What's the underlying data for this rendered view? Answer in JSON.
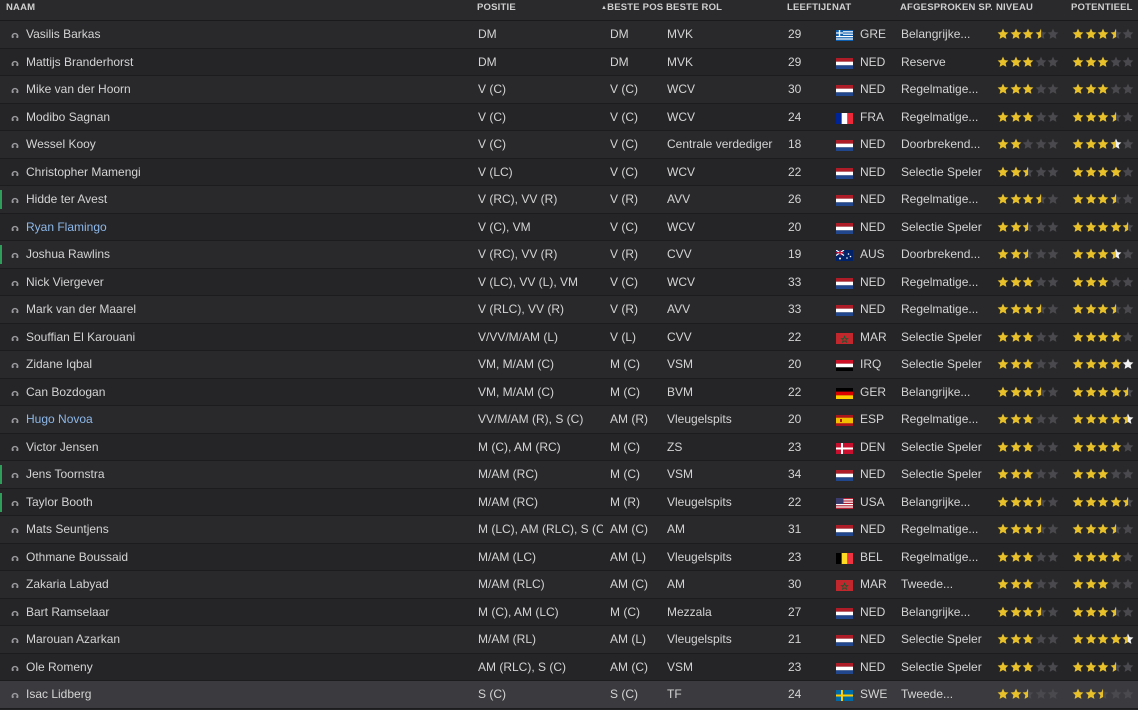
{
  "columns": [
    {
      "key": "naam",
      "label": "NAAM"
    },
    {
      "key": "positie",
      "label": "POSITIE"
    },
    {
      "key": "beste_pos",
      "label": "BESTE POS"
    },
    {
      "key": "beste_rol",
      "label": "BESTE ROL"
    },
    {
      "key": "leeftijd",
      "label": "LEEFTIJD"
    },
    {
      "key": "nat",
      "label": "NAT"
    },
    {
      "key": "afgesproken",
      "label": "AFGESPROKEN SP..."
    },
    {
      "key": "niveau",
      "label": "NIVEAU"
    },
    {
      "key": "potentieel",
      "label": "POTENTIEEL"
    }
  ],
  "sort": {
    "column": "beste_pos",
    "indicator": "▲"
  },
  "colors": {
    "star_filled": "#e8c12a",
    "star_empty": "#4a4a4e",
    "star_white": "#f2f2f2",
    "link": "#8db8e8",
    "accent": "#2e9e5a"
  },
  "rows": [
    {
      "name": "Vasilis Barkas",
      "positie": "DM",
      "beste_pos": "DM",
      "beste_rol": "MVK",
      "leeftijd": "29",
      "nat": "GRE",
      "flag": "gre",
      "afgesproken": "Belangrijke...",
      "niveau": 3.5,
      "potentieel": 3.5
    },
    {
      "name": "Mattijs Branderhorst",
      "positie": "DM",
      "beste_pos": "DM",
      "beste_rol": "MVK",
      "leeftijd": "29",
      "nat": "NED",
      "flag": "ned",
      "afgesproken": "Reserve",
      "niveau": 3,
      "potentieel": 3
    },
    {
      "name": "Mike van der Hoorn",
      "positie": "V (C)",
      "beste_pos": "V (C)",
      "beste_rol": "WCV",
      "leeftijd": "30",
      "nat": "NED",
      "flag": "ned",
      "afgesproken": "Regelmatige...",
      "niveau": 3,
      "potentieel": 3
    },
    {
      "name": "Modibo Sagnan",
      "positie": "V (C)",
      "beste_pos": "V (C)",
      "beste_rol": "WCV",
      "leeftijd": "24",
      "nat": "FRA",
      "flag": "fra",
      "afgesproken": "Regelmatige...",
      "niveau": 3,
      "potentieel": 3.5
    },
    {
      "name": "Wessel Kooy",
      "positie": "V (C)",
      "beste_pos": "V (C)",
      "beste_rol": "Centrale verdediger",
      "leeftijd": "18",
      "nat": "NED",
      "flag": "ned",
      "afgesproken": "Doorbrekend...",
      "niveau": 2,
      "potentieel": 3.5,
      "pot_white_half": true
    },
    {
      "name": "Christopher Mamengi",
      "positie": "V (LC)",
      "beste_pos": "V (C)",
      "beste_rol": "WCV",
      "leeftijd": "22",
      "nat": "NED",
      "flag": "ned",
      "afgesproken": "Selectie Speler",
      "niveau": 2.5,
      "potentieel": 4
    },
    {
      "name": "Hidde ter Avest",
      "positie": "V (RC), VV (R)",
      "beste_pos": "V (R)",
      "beste_rol": "AVV",
      "leeftijd": "26",
      "nat": "NED",
      "flag": "ned",
      "afgesproken": "Regelmatige...",
      "niveau": 3.5,
      "potentieel": 3.5,
      "accent": true
    },
    {
      "name": "Ryan Flamingo",
      "positie": "V (C), VM",
      "beste_pos": "V (C)",
      "beste_rol": "WCV",
      "leeftijd": "20",
      "nat": "NED",
      "flag": "ned",
      "afgesproken": "Selectie Speler",
      "niveau": 2.5,
      "potentieel": 4.5,
      "link": true
    },
    {
      "name": "Joshua Rawlins",
      "positie": "V (RC), VV (R)",
      "beste_pos": "V (R)",
      "beste_rol": "CVV",
      "leeftijd": "19",
      "nat": "AUS",
      "flag": "aus",
      "afgesproken": "Doorbrekend...",
      "niveau": 2.5,
      "potentieel": 3.5,
      "pot_white_half": true,
      "accent": true
    },
    {
      "name": "Nick Viergever",
      "positie": "V (LC), VV (L), VM",
      "beste_pos": "V (C)",
      "beste_rol": "WCV",
      "leeftijd": "33",
      "nat": "NED",
      "flag": "ned",
      "afgesproken": "Regelmatige...",
      "niveau": 3,
      "potentieel": 3
    },
    {
      "name": "Mark van der Maarel",
      "positie": "V (RLC), VV (R)",
      "beste_pos": "V (R)",
      "beste_rol": "AVV",
      "leeftijd": "33",
      "nat": "NED",
      "flag": "ned",
      "afgesproken": "Regelmatige...",
      "niveau": 3.5,
      "potentieel": 3.5
    },
    {
      "name": "Souffian El Karouani",
      "positie": "V/VV/M/AM (L)",
      "beste_pos": "V (L)",
      "beste_rol": "CVV",
      "leeftijd": "22",
      "nat": "MAR",
      "flag": "mar",
      "afgesproken": "Selectie Speler",
      "niveau": 3,
      "potentieel": 4
    },
    {
      "name": "Zidane Iqbal",
      "positie": "VM, M/AM (C)",
      "beste_pos": "M (C)",
      "beste_rol": "VSM",
      "leeftijd": "20",
      "nat": "IRQ",
      "flag": "irq",
      "afgesproken": "Selectie Speler",
      "niveau": 3,
      "potentieel": 5,
      "pot_last_white": true
    },
    {
      "name": "Can Bozdogan",
      "positie": "VM, M/AM (C)",
      "beste_pos": "M (C)",
      "beste_rol": "BVM",
      "leeftijd": "22",
      "nat": "GER",
      "flag": "ger",
      "afgesproken": "Belangrijke...",
      "niveau": 3.5,
      "potentieel": 4.5
    },
    {
      "name": "Hugo Novoa",
      "positie": "VV/M/AM (R), S (C)",
      "beste_pos": "AM (R)",
      "beste_rol": "Vleugelspits",
      "leeftijd": "20",
      "nat": "ESP",
      "flag": "esp",
      "afgesproken": "Regelmatige...",
      "niveau": 3,
      "potentieel": 4.5,
      "pot_white_half": true,
      "link": true
    },
    {
      "name": "Victor Jensen",
      "positie": "M (C), AM (RC)",
      "beste_pos": "M (C)",
      "beste_rol": "ZS",
      "leeftijd": "23",
      "nat": "DEN",
      "flag": "den",
      "afgesproken": "Selectie Speler",
      "niveau": 3,
      "potentieel": 4
    },
    {
      "name": "Jens Toornstra",
      "positie": "M/AM (RC)",
      "beste_pos": "M (C)",
      "beste_rol": "VSM",
      "leeftijd": "34",
      "nat": "NED",
      "flag": "ned",
      "afgesproken": "Selectie Speler",
      "niveau": 3,
      "potentieel": 3,
      "accent": true
    },
    {
      "name": "Taylor Booth",
      "positie": "M/AM (RC)",
      "beste_pos": "M (R)",
      "beste_rol": "Vleugelspits",
      "leeftijd": "22",
      "nat": "USA",
      "flag": "usa",
      "afgesproken": "Belangrijke...",
      "niveau": 3.5,
      "potentieel": 4.5,
      "accent": true
    },
    {
      "name": "Mats Seuntjens",
      "positie": "M (LC), AM (RLC), S (C)",
      "beste_pos": "AM (C)",
      "beste_rol": "AM",
      "leeftijd": "31",
      "nat": "NED",
      "flag": "ned",
      "afgesproken": "Regelmatige...",
      "niveau": 3.5,
      "potentieel": 3.5
    },
    {
      "name": "Othmane Boussaid",
      "positie": "M/AM (LC)",
      "beste_pos": "AM (L)",
      "beste_rol": "Vleugelspits",
      "leeftijd": "23",
      "nat": "BEL",
      "flag": "bel",
      "afgesproken": "Regelmatige...",
      "niveau": 3,
      "potentieel": 4
    },
    {
      "name": "Zakaria Labyad",
      "positie": "M/AM (RLC)",
      "beste_pos": "AM (C)",
      "beste_rol": "AM",
      "leeftijd": "30",
      "nat": "MAR",
      "flag": "mar",
      "afgesproken": "Tweede...",
      "niveau": 3,
      "potentieel": 3
    },
    {
      "name": "Bart Ramselaar",
      "positie": "M (C), AM (LC)",
      "beste_pos": "M (C)",
      "beste_rol": "Mezzala",
      "leeftijd": "27",
      "nat": "NED",
      "flag": "ned",
      "afgesproken": "Belangrijke...",
      "niveau": 3.5,
      "potentieel": 3.5
    },
    {
      "name": "Marouan Azarkan",
      "positie": "M/AM (RL)",
      "beste_pos": "AM (L)",
      "beste_rol": "Vleugelspits",
      "leeftijd": "21",
      "nat": "NED",
      "flag": "ned",
      "afgesproken": "Selectie Speler",
      "niveau": 3,
      "potentieel": 4.5,
      "pot_white_half": true
    },
    {
      "name": "Ole Romeny",
      "positie": "AM (RLC), S (C)",
      "beste_pos": "AM (C)",
      "beste_rol": "VSM",
      "leeftijd": "23",
      "nat": "NED",
      "flag": "ned",
      "afgesproken": "Selectie Speler",
      "niveau": 3,
      "potentieel": 3.5
    },
    {
      "name": "Isac Lidberg",
      "positie": "S (C)",
      "beste_pos": "S (C)",
      "beste_rol": "TF",
      "leeftijd": "24",
      "nat": "SWE",
      "flag": "swe",
      "afgesproken": "Tweede...",
      "niveau": 2.5,
      "potentieel": 2.5,
      "selected": true
    }
  ]
}
